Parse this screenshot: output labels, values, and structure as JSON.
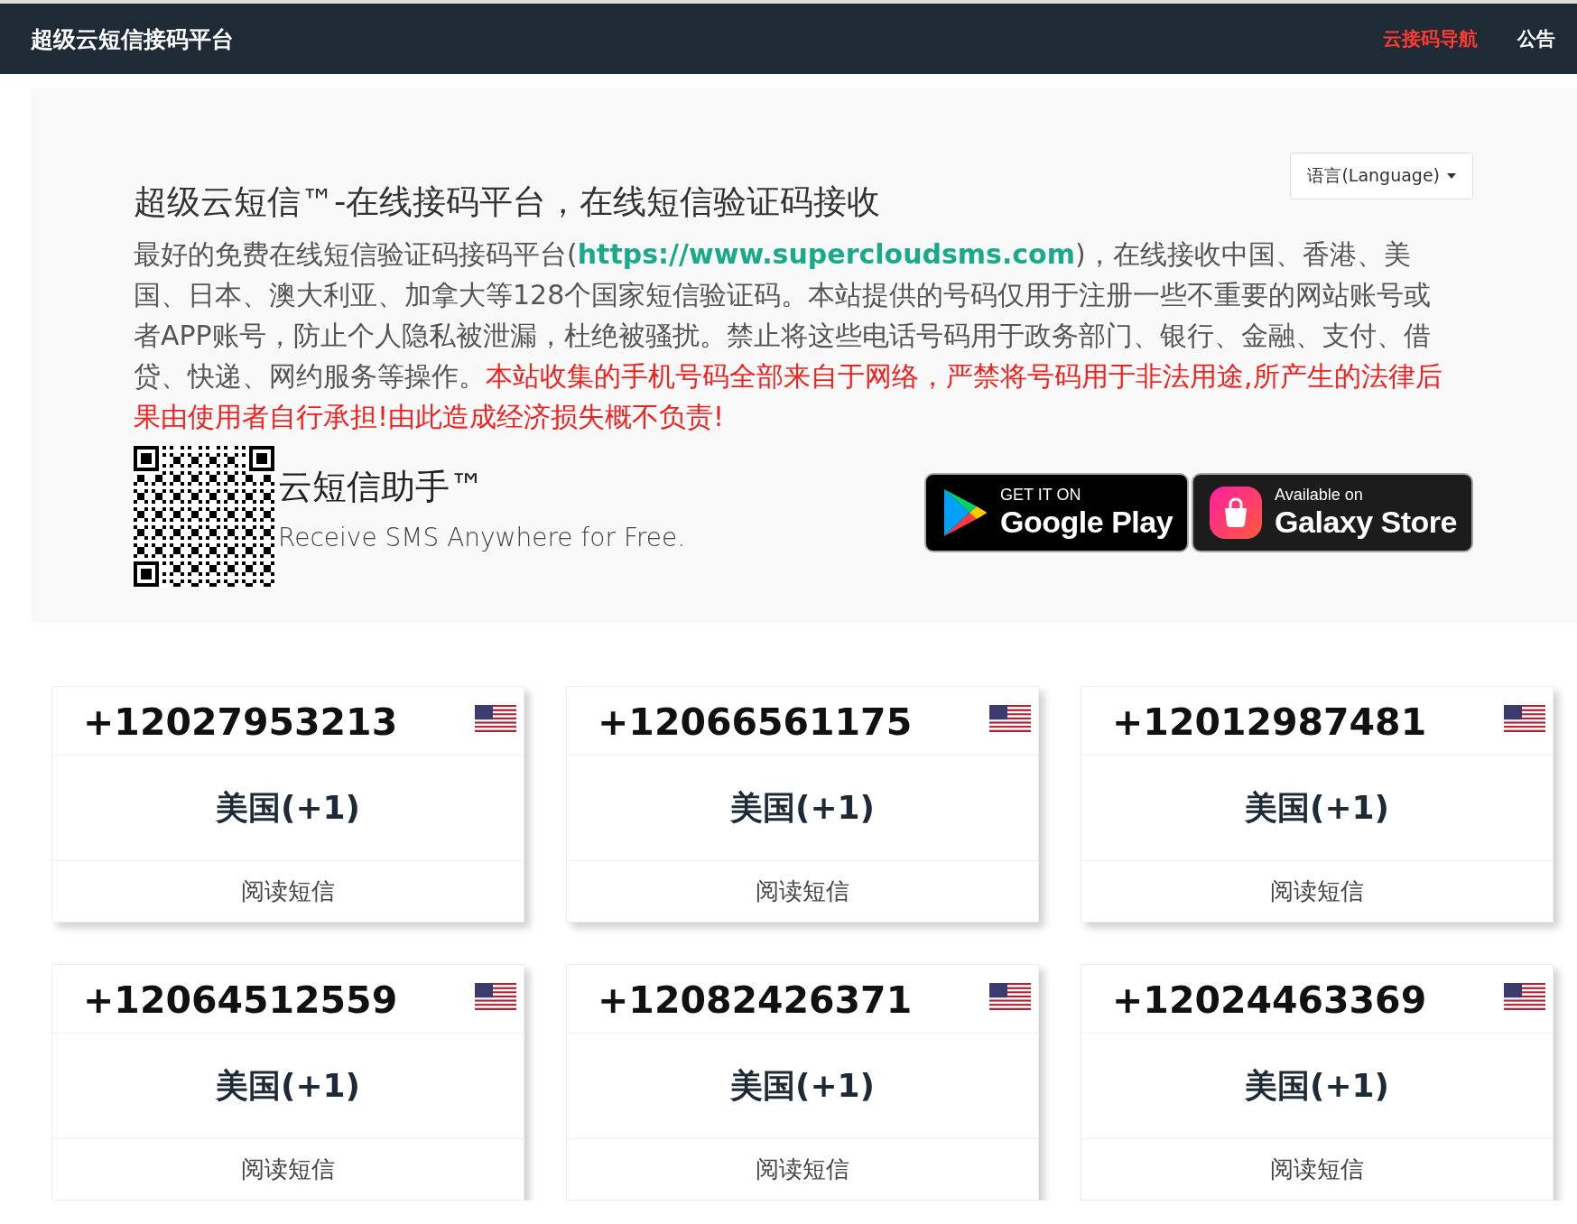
{
  "navbar": {
    "brand": "超级云短信接码平台",
    "links": [
      {
        "label": "云接码导航",
        "highlighted": true
      },
      {
        "label": "公告",
        "highlighted": false
      }
    ]
  },
  "hero": {
    "language_button": "语言(Language)",
    "title": "超级云短信™-在线接码平台，在线短信验证码接收",
    "description": {
      "before_link": "最好的免费在线短信验证码接码平台(",
      "link": "https://www.supercloudsms.com",
      "after_link": ")，在线接收中国、香港、美国、日本、澳大利亚、加拿大等128个国家短信验证码。本站提供的号码仅用于注册一些不重要的网站账号或者APP账号，防止个人隐私被泄漏，杜绝被骚扰。禁止将这些电话号码用于政务部门、银行、金融、支付、借贷、快递、网约服务等操作。",
      "warning": "本站收集的手机号码全部来自于网络，严禁将号码用于非法用途,所产生的法律后果由使用者自行承担!由此造成经济损失概不负责!"
    },
    "app": {
      "name": "云短信助手™",
      "tagline": "Receive SMS Anywhere for Free."
    },
    "store_badges": [
      {
        "kind": "google",
        "small": "GET IT ON",
        "large": "Google Play"
      },
      {
        "kind": "galaxy",
        "small": "Available on",
        "large": "Galaxy Store"
      }
    ]
  },
  "numbers": [
    {
      "phone": "+12027953213",
      "country": "美国(+1)",
      "action": "阅读短信"
    },
    {
      "phone": "+12066561175",
      "country": "美国(+1)",
      "action": "阅读短信"
    },
    {
      "phone": "+12012987481",
      "country": "美国(+1)",
      "action": "阅读短信"
    },
    {
      "phone": "+12064512559",
      "country": "美国(+1)",
      "action": "阅读短信"
    },
    {
      "phone": "+12082426371",
      "country": "美国(+1)",
      "action": "阅读短信"
    },
    {
      "phone": "+12024463369",
      "country": "美国(+1)",
      "action": "阅读短信"
    }
  ]
}
